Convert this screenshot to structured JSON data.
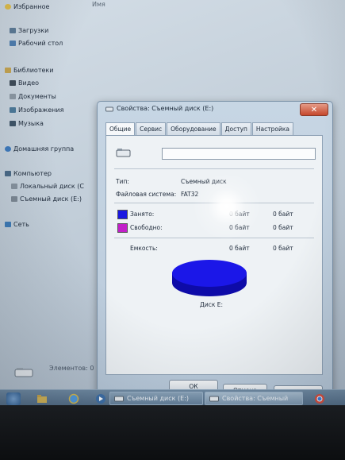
{
  "explorer": {
    "column_header": "Имя",
    "nav": {
      "favorites": "Избранное",
      "downloads": "Загрузки",
      "desktop": "Рабочий стол",
      "libraries": "Библиотеки",
      "videos": "Видео",
      "documents": "Документы",
      "images": "Изображения",
      "music": "Музыка",
      "homegroup": "Домашняя группа",
      "computer": "Компьютер",
      "local_disk": "Локальный диск (С",
      "removable_disk": "Съемный диск (E:)",
      "network": "Сеть"
    },
    "status_items": "Элементов: 0"
  },
  "dialog": {
    "title": "Свойства: Съемный диск (E:)",
    "close_label": "✕",
    "tabs": [
      {
        "label": "Общие",
        "active": true
      },
      {
        "label": "Сервис",
        "active": false
      },
      {
        "label": "Оборудование",
        "active": false
      },
      {
        "label": "Доступ",
        "active": false
      },
      {
        "label": "Настройка",
        "active": false
      }
    ],
    "name_value": "",
    "type_label": "Тип:",
    "type_value": "Съемный диск",
    "fs_label": "Файловая система:",
    "fs_value": "FAT32",
    "used_label": "Занято:",
    "used_value": "0 байт",
    "used_value2": "0 байт",
    "free_label": "Свободно:",
    "free_value": "0 байт",
    "free_value2": "0 байт",
    "capacity_label": "Емкость:",
    "capacity_value": "0 байт",
    "capacity_value2": "0 байт",
    "disk_label": "Диск E:",
    "buttons": {
      "ok": "ОК",
      "cancel": "Отмена",
      "apply": "Применить"
    },
    "colors": {
      "used": "#1a17e0",
      "free": "#c21fc9",
      "pie": "#1b17e8"
    }
  },
  "taskbar": {
    "items": [
      {
        "label": "Съемный диск (E:)"
      },
      {
        "label": "Свойства: Съемный"
      }
    ]
  }
}
